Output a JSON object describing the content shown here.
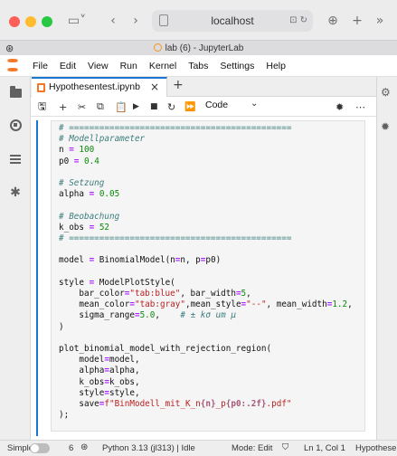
{
  "browser": {
    "url": "localhost",
    "tab_title": "lab (6) - JupyterLab"
  },
  "menubar": {
    "items": [
      "File",
      "Edit",
      "View",
      "Run",
      "Kernel",
      "Tabs",
      "Settings",
      "Help"
    ]
  },
  "doc_tab": {
    "label": "Hypothesentest.ipynb",
    "close": "×",
    "new": "+"
  },
  "toolbar": {
    "cell_type": "Code"
  },
  "code_lines": [
    [
      {
        "t": "# ============================================",
        "c": "c-com"
      }
    ],
    [
      {
        "t": "# Modellparameter",
        "c": "c-com"
      }
    ],
    [
      {
        "t": "n ",
        "c": ""
      },
      {
        "t": "=",
        "c": "c-op"
      },
      {
        "t": " ",
        "c": ""
      },
      {
        "t": "100",
        "c": "c-num"
      }
    ],
    [
      {
        "t": "p0 ",
        "c": ""
      },
      {
        "t": "=",
        "c": "c-op"
      },
      {
        "t": " ",
        "c": ""
      },
      {
        "t": "0.4",
        "c": "c-num"
      }
    ],
    [
      {
        "t": "",
        "c": ""
      }
    ],
    [
      {
        "t": "# Setzung",
        "c": "c-com"
      }
    ],
    [
      {
        "t": "alpha ",
        "c": ""
      },
      {
        "t": "=",
        "c": "c-op"
      },
      {
        "t": " ",
        "c": ""
      },
      {
        "t": "0.05",
        "c": "c-num"
      }
    ],
    [
      {
        "t": "",
        "c": ""
      }
    ],
    [
      {
        "t": "# Beobachung",
        "c": "c-com"
      }
    ],
    [
      {
        "t": "k_obs ",
        "c": ""
      },
      {
        "t": "=",
        "c": "c-op"
      },
      {
        "t": " ",
        "c": ""
      },
      {
        "t": "52",
        "c": "c-num"
      }
    ],
    [
      {
        "t": "# ============================================",
        "c": "c-com"
      }
    ],
    [
      {
        "t": "",
        "c": ""
      }
    ],
    [
      {
        "t": "model ",
        "c": ""
      },
      {
        "t": "=",
        "c": "c-op"
      },
      {
        "t": " BinomialModel(n",
        "c": ""
      },
      {
        "t": "=",
        "c": "c-op"
      },
      {
        "t": "n, p",
        "c": ""
      },
      {
        "t": "=",
        "c": "c-op"
      },
      {
        "t": "p0)",
        "c": ""
      }
    ],
    [
      {
        "t": "",
        "c": ""
      }
    ],
    [
      {
        "t": "style ",
        "c": ""
      },
      {
        "t": "=",
        "c": "c-op"
      },
      {
        "t": " ModelPlotStyle(",
        "c": ""
      }
    ],
    [
      {
        "t": "    bar_color",
        "c": ""
      },
      {
        "t": "=",
        "c": "c-op"
      },
      {
        "t": "\"tab:blue\"",
        "c": "c-str"
      },
      {
        "t": ", bar_width",
        "c": ""
      },
      {
        "t": "=",
        "c": "c-op"
      },
      {
        "t": "5",
        "c": "c-num"
      },
      {
        "t": ",",
        "c": ""
      }
    ],
    [
      {
        "t": "    mean_color",
        "c": ""
      },
      {
        "t": "=",
        "c": "c-op"
      },
      {
        "t": "\"tab:gray\"",
        "c": "c-str"
      },
      {
        "t": ",mean_style",
        "c": ""
      },
      {
        "t": "=",
        "c": "c-op"
      },
      {
        "t": "\"--\"",
        "c": "c-str"
      },
      {
        "t": ", mean_width",
        "c": ""
      },
      {
        "t": "=",
        "c": "c-op"
      },
      {
        "t": "1.2",
        "c": "c-num"
      },
      {
        "t": ",",
        "c": ""
      }
    ],
    [
      {
        "t": "    sigma_range",
        "c": ""
      },
      {
        "t": "=",
        "c": "c-op"
      },
      {
        "t": "5.0",
        "c": "c-num"
      },
      {
        "t": ",    ",
        "c": ""
      },
      {
        "t": "# ± kσ um μ",
        "c": "c-com"
      }
    ],
    [
      {
        "t": ")",
        "c": ""
      }
    ],
    [
      {
        "t": "",
        "c": ""
      }
    ],
    [
      {
        "t": "plot_binomial_model_with_rejection_region(",
        "c": ""
      }
    ],
    [
      {
        "t": "    model",
        "c": ""
      },
      {
        "t": "=",
        "c": "c-op"
      },
      {
        "t": "model,",
        "c": ""
      }
    ],
    [
      {
        "t": "    alpha",
        "c": ""
      },
      {
        "t": "=",
        "c": "c-op"
      },
      {
        "t": "alpha,",
        "c": ""
      }
    ],
    [
      {
        "t": "    k_obs",
        "c": ""
      },
      {
        "t": "=",
        "c": "c-op"
      },
      {
        "t": "k_obs,",
        "c": ""
      }
    ],
    [
      {
        "t": "    style",
        "c": ""
      },
      {
        "t": "=",
        "c": "c-op"
      },
      {
        "t": "style,",
        "c": ""
      }
    ],
    [
      {
        "t": "    save",
        "c": ""
      },
      {
        "t": "=",
        "c": "c-op"
      },
      {
        "t": "f\"BinModell_mit_K_n",
        "c": "c-str"
      },
      {
        "t": "{n}",
        "c": "c-fmt"
      },
      {
        "t": "_p",
        "c": "c-str"
      },
      {
        "t": "{p0:.2f}",
        "c": "c-fmt"
      },
      {
        "t": ".pdf\"",
        "c": "c-str"
      }
    ],
    [
      {
        "t": ");",
        "c": ""
      }
    ]
  ],
  "statusbar": {
    "mode_label": "Simple",
    "terminals": "6",
    "kernel": "Python 3.13 (jl313) | Idle",
    "edit_mode": "Mode: Edit",
    "position": "Ln 1, Col 1",
    "file": "Hypothesentest.ipynb"
  }
}
